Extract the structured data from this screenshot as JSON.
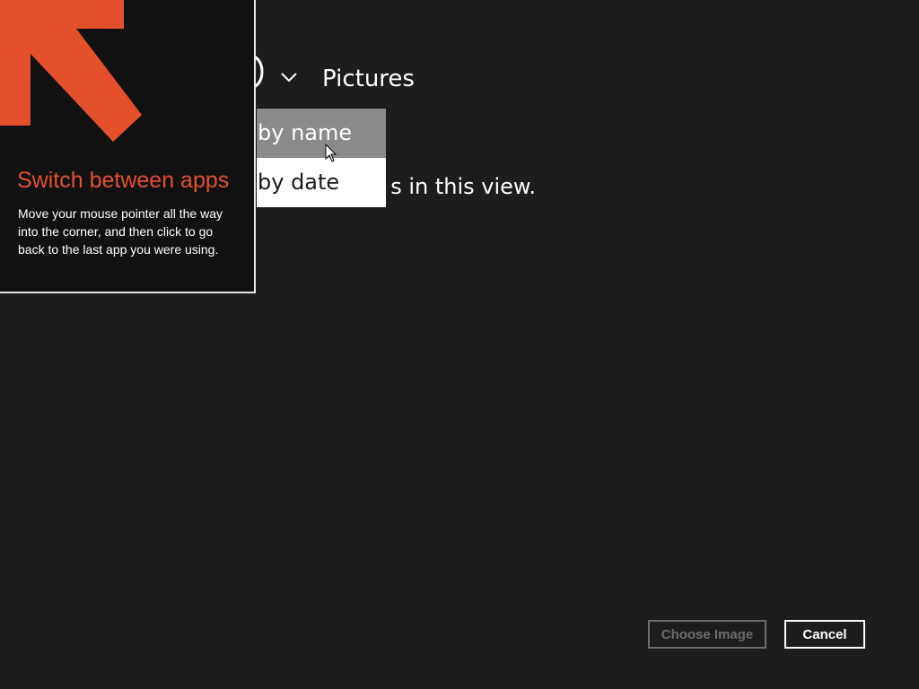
{
  "header": {
    "location": "Pictures",
    "location_menu_icon": "chevron-down-icon",
    "back_icon": "back-arc-icon"
  },
  "main": {
    "empty_message": "s in this view."
  },
  "sort_menu": {
    "items": [
      {
        "label": "by name",
        "state": "hover"
      },
      {
        "label": "by date",
        "state": "normal"
      }
    ]
  },
  "tip": {
    "icon": "arrow-up-left-icon",
    "title": "Switch between apps",
    "body": "Move your mouse pointer all the way into the corner, and then click to go back to the last app you were using.",
    "accent_color": "#e4502b"
  },
  "footer": {
    "choose_label": "Choose Image",
    "cancel_label": "Cancel"
  }
}
